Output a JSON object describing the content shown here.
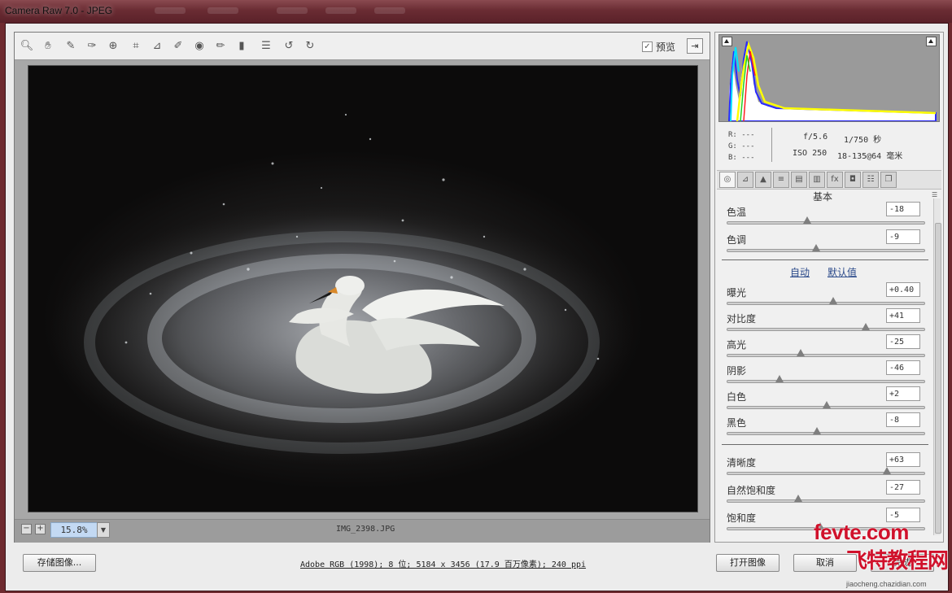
{
  "window": {
    "title": "Camera Raw 7.0 -  JPEG"
  },
  "toolbar": {
    "tools": [
      "zoom-icon",
      "hand-icon",
      "white-balance-icon",
      "color-sampler-icon",
      "target-adjust-icon",
      "crop-icon",
      "straighten-icon",
      "spot-removal-icon",
      "red-eye-icon",
      "adjustment-brush-icon",
      "graduated-filter-icon",
      "preferences-icon",
      "rotate-left-icon",
      "rotate-right-icon"
    ],
    "preview_label": "预览"
  },
  "status": {
    "zoom": "15.8%",
    "filename": "IMG_2398.JPG"
  },
  "histogram": {
    "rgb": [
      "R: ---",
      "G: ---",
      "B: ---"
    ],
    "aperture": "f/5.6",
    "shutter": "1/750 秒",
    "iso": "ISO 250",
    "lens": "18-135@64 毫米"
  },
  "panel": {
    "title": "基本",
    "auto_label": "自动",
    "default_label": "默认值",
    "white_balance": [
      {
        "label": "色温",
        "value": "-18",
        "level": 0.41
      },
      {
        "label": "色调",
        "value": "-9",
        "level": 0.455
      }
    ],
    "tone": [
      {
        "label": "曝光",
        "value": "+0.40",
        "level": 0.54
      },
      {
        "label": "对比度",
        "value": "+41",
        "level": 0.705
      },
      {
        "label": "高光",
        "value": "-25",
        "level": 0.375
      },
      {
        "label": "阴影",
        "value": "-46",
        "level": 0.27
      },
      {
        "label": "白色",
        "value": "+2",
        "level": 0.51
      },
      {
        "label": "黑色",
        "value": "-8",
        "level": 0.46
      }
    ],
    "presence": [
      {
        "label": "清晰度",
        "value": "+63",
        "level": 0.815
      },
      {
        "label": "自然饱和度",
        "value": "-27",
        "level": 0.365
      },
      {
        "label": "饱和度",
        "value": "-5",
        "level": 0.475
      }
    ]
  },
  "footer": {
    "save_label": "存储图像...",
    "workflow_text": "Adobe RGB (1998); 8 位; 5184 x 3456 (17.9 百万像素); 240 ppi",
    "open_label": "打开图像",
    "cancel_label": "取消",
    "done_label": "完成"
  },
  "watermark": {
    "brand": "fevte.com",
    "cn": "飞特教程网",
    "url": "jiaocheng.chazidian.com"
  },
  "colors": {
    "title_bar": "#6a2c33",
    "zoom_field": "#c3d9f3",
    "link": "#2b4a8a",
    "watermark": "#d0112b"
  }
}
